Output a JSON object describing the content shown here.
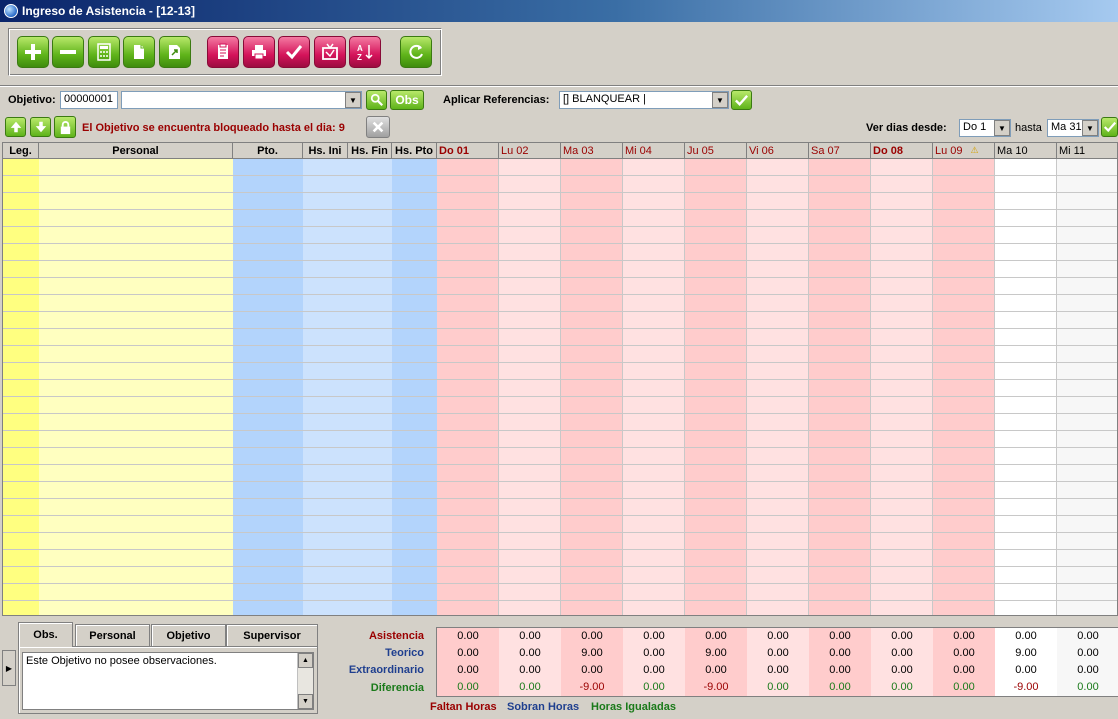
{
  "window": {
    "title": "Ingreso de Asistencia - [12-13]"
  },
  "toolbar": {
    "buttons": [
      {
        "name": "add-button",
        "icon": "plus-icon",
        "color": "green"
      },
      {
        "name": "remove-button",
        "icon": "minus-icon",
        "color": "green"
      },
      {
        "name": "calculator-button",
        "icon": "calculator-icon",
        "color": "green"
      },
      {
        "name": "copy-button",
        "icon": "copy-icon",
        "color": "green"
      },
      {
        "name": "export-button",
        "icon": "export-icon",
        "color": "green"
      },
      {
        "name": "report-button",
        "icon": "clipboard-icon",
        "color": "red"
      },
      {
        "name": "print-button",
        "icon": "printer-icon",
        "color": "red"
      },
      {
        "name": "check-button",
        "icon": "checkmark-icon",
        "color": "red"
      },
      {
        "name": "tv-button",
        "icon": "tv-icon",
        "color": "red"
      },
      {
        "name": "sort-button",
        "icon": "sort-az-icon",
        "color": "red"
      },
      {
        "name": "refresh-button",
        "icon": "refresh-icon",
        "color": "green"
      }
    ]
  },
  "filters": {
    "objetivo_label": "Objetivo:",
    "objetivo_code": "00000001",
    "objetivo_desc": "",
    "obs_label": "Obs",
    "referencias_label": "Aplicar Referencias:",
    "referencias_value": "[] BLANQUEAR |"
  },
  "status": {
    "message": "El Objetivo se encuentra bloqueado hasta el dia: 9",
    "ver_dias_label": "Ver dias desde:",
    "desde_value": "Do 1",
    "hasta_label": "hasta",
    "hasta_value": "Ma 31"
  },
  "grid": {
    "columns": [
      {
        "label": "Leg."
      },
      {
        "label": "Personal"
      },
      {
        "label": "Pto."
      },
      {
        "label": "Hs. Ini"
      },
      {
        "label": "Hs. Fin"
      },
      {
        "label": "Hs. Pto"
      }
    ],
    "days": [
      {
        "label": "Do 01",
        "bold": true
      },
      {
        "label": "Lu 02",
        "bold": false
      },
      {
        "label": "Ma 03",
        "bold": false
      },
      {
        "label": "Mi 04",
        "bold": false
      },
      {
        "label": "Ju 05",
        "bold": false
      },
      {
        "label": "Vi 06",
        "bold": false
      },
      {
        "label": "Sa 07",
        "bold": false
      },
      {
        "label": "Do 08",
        "bold": true
      },
      {
        "label": "Lu 09",
        "bold": false,
        "warning": true
      },
      {
        "label": "Ma 10",
        "bold": false
      },
      {
        "label": "Mi 11",
        "bold": false
      }
    ],
    "colors": {
      "leg": "#ffff80",
      "personal": "#ffffc0",
      "pto": "#b3d4fc",
      "hs": "#cce2fd",
      "hs_pto": "#b3d4fc",
      "day_dark": "#ffcccc",
      "day_light": "#ffe1e1",
      "day_open": "#ffffff",
      "day_open_alt": "#f7f7f7"
    }
  },
  "tabs": [
    {
      "label": "Obs.",
      "active": true
    },
    {
      "label": "Personal",
      "active": false
    },
    {
      "label": "Objetivo",
      "active": false
    },
    {
      "label": "Supervisor",
      "active": false
    }
  ],
  "observations": {
    "text": "Este Objetivo no posee observaciones."
  },
  "summary": {
    "rows": [
      {
        "label": "Asistencia",
        "color": "#9a0000",
        "values": [
          "0.00",
          "0.00",
          "0.00",
          "0.00",
          "0.00",
          "0.00",
          "0.00",
          "0.00",
          "0.00",
          "0.00",
          "0.00"
        ]
      },
      {
        "label": "Teorico",
        "color": "#1f3f8f",
        "values": [
          "0.00",
          "0.00",
          "9.00",
          "0.00",
          "9.00",
          "0.00",
          "0.00",
          "0.00",
          "0.00",
          "9.00",
          "0.00"
        ]
      },
      {
        "label": "Extraordinario",
        "color": "#1f3f8f",
        "values": [
          "0.00",
          "0.00",
          "0.00",
          "0.00",
          "0.00",
          "0.00",
          "0.00",
          "0.00",
          "0.00",
          "0.00",
          "0.00"
        ]
      },
      {
        "label": "Diferencia",
        "color": "#1a7a1a",
        "values": [
          "0.00",
          "0.00",
          "-9.00",
          "0.00",
          "-9.00",
          "0.00",
          "0.00",
          "0.00",
          "0.00",
          "-9.00",
          "0.00"
        ]
      }
    ],
    "value_colors": {
      "Asistencia": "#000000",
      "Teorico": "#000000",
      "Extraordinario": "#000000",
      "Diferencia_neg": "#9a0000",
      "Diferencia_zero": "#1a7a1a"
    }
  },
  "legend": [
    {
      "label": "Faltan Horas",
      "color": "#9a0000"
    },
    {
      "label": "Sobran Horas",
      "color": "#1f3f8f"
    },
    {
      "label": "Horas Igualadas",
      "color": "#1a7a1a"
    }
  ]
}
